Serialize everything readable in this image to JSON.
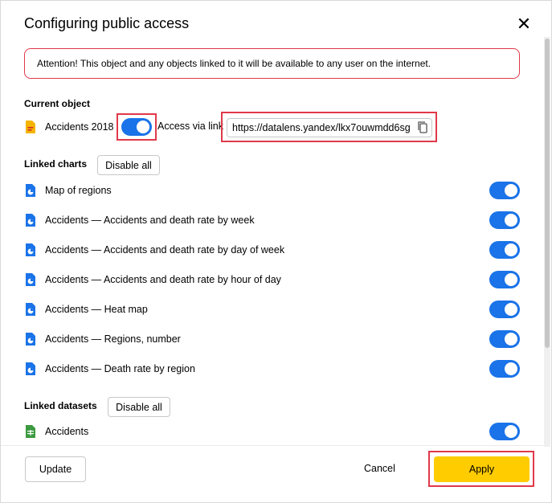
{
  "dialog": {
    "title": "Configuring public access",
    "close_icon": "close-icon"
  },
  "alert": {
    "text": "Attention! This object and any objects linked to it will be available to any user on the internet."
  },
  "current_object": {
    "heading": "Current object",
    "name": "Accidents 2018",
    "enabled": true,
    "access_label": "Access via link",
    "url": "https://datalens.yandex/lkx7ouwmdd6sg",
    "icon": "dashboard-icon"
  },
  "linked_charts": {
    "heading": "Linked charts",
    "disable_all": "Disable all",
    "items": [
      {
        "label": "Map of regions",
        "enabled": true
      },
      {
        "label": "Accidents — Accidents and death rate by week",
        "enabled": true
      },
      {
        "label": "Accidents — Accidents and death rate by day of week",
        "enabled": true
      },
      {
        "label": "Accidents — Accidents and death rate by hour of day",
        "enabled": true
      },
      {
        "label": "Accidents — Heat map",
        "enabled": true
      },
      {
        "label": "Accidents — Regions, number",
        "enabled": true
      },
      {
        "label": "Accidents — Death rate by region",
        "enabled": true
      }
    ]
  },
  "linked_datasets": {
    "heading": "Linked datasets",
    "disable_all": "Disable all",
    "items": [
      {
        "label": "Accidents",
        "enabled": true
      }
    ]
  },
  "footer": {
    "update": "Update",
    "cancel": "Cancel",
    "apply": "Apply"
  },
  "colors": {
    "toggle_on": "#1a73e8",
    "apply_bg": "#ffcc00",
    "highlight": "#e0394a",
    "chart_icon": "#1a73e8",
    "dataset_icon": "#3c9a40"
  }
}
